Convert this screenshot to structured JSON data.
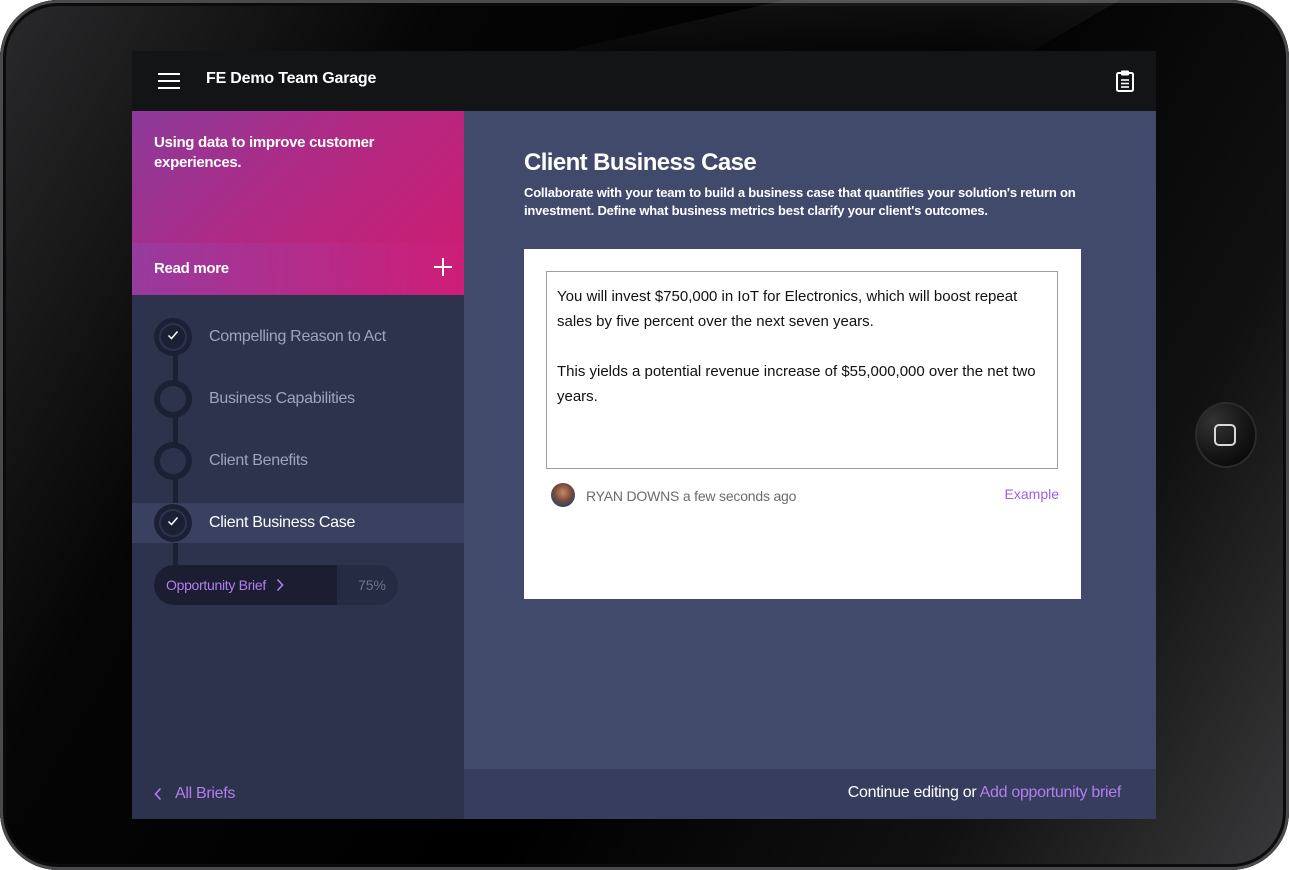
{
  "app": {
    "title": "FE Demo Team Garage",
    "menu_icon": "hamburger-menu-icon",
    "clipboard_icon": "clipboard-icon"
  },
  "sidebar": {
    "hero_text": "Using data to improve customer experiences.",
    "read_more_label": "Read more",
    "steps": [
      {
        "label": "Compelling Reason to Act",
        "state": "complete"
      },
      {
        "label": "Business Capabilities",
        "state": "in-progress"
      },
      {
        "label": "Client Benefits",
        "state": "incomplete"
      },
      {
        "label": "Client Business Case",
        "state": "active"
      }
    ],
    "progress": {
      "label": "Opportunity Brief",
      "percent_text": "75%",
      "percent": 75
    }
  },
  "main": {
    "title": "Client Business Case",
    "description": "Collaborate with your team to build a business case that quantifies your solution's return on investment. Define what business metrics best clarify your client's outcomes.",
    "editor": {
      "paragraph_1": "You will invest $750,000 in IoT for Electronics, which will boost repeat sales by five percent over the next seven years.",
      "paragraph_2": "This yields a potential revenue increase of $55,000,000 over the net two years."
    },
    "author_name": "RYAN DOWNS",
    "timestamp": "a few seconds ago",
    "example_link": "Example"
  },
  "footer": {
    "back_label": "All Briefs",
    "continue_text": "Continue editing or ",
    "add_link": "Add opportunity brief"
  },
  "colors": {
    "accent": "#b57cf2",
    "hero_start": "#8b3a9b",
    "hero_end": "#d01b70",
    "topbar": "#121415",
    "main_bg": "#424a6c",
    "sidebar_bg": "#2e334d"
  }
}
